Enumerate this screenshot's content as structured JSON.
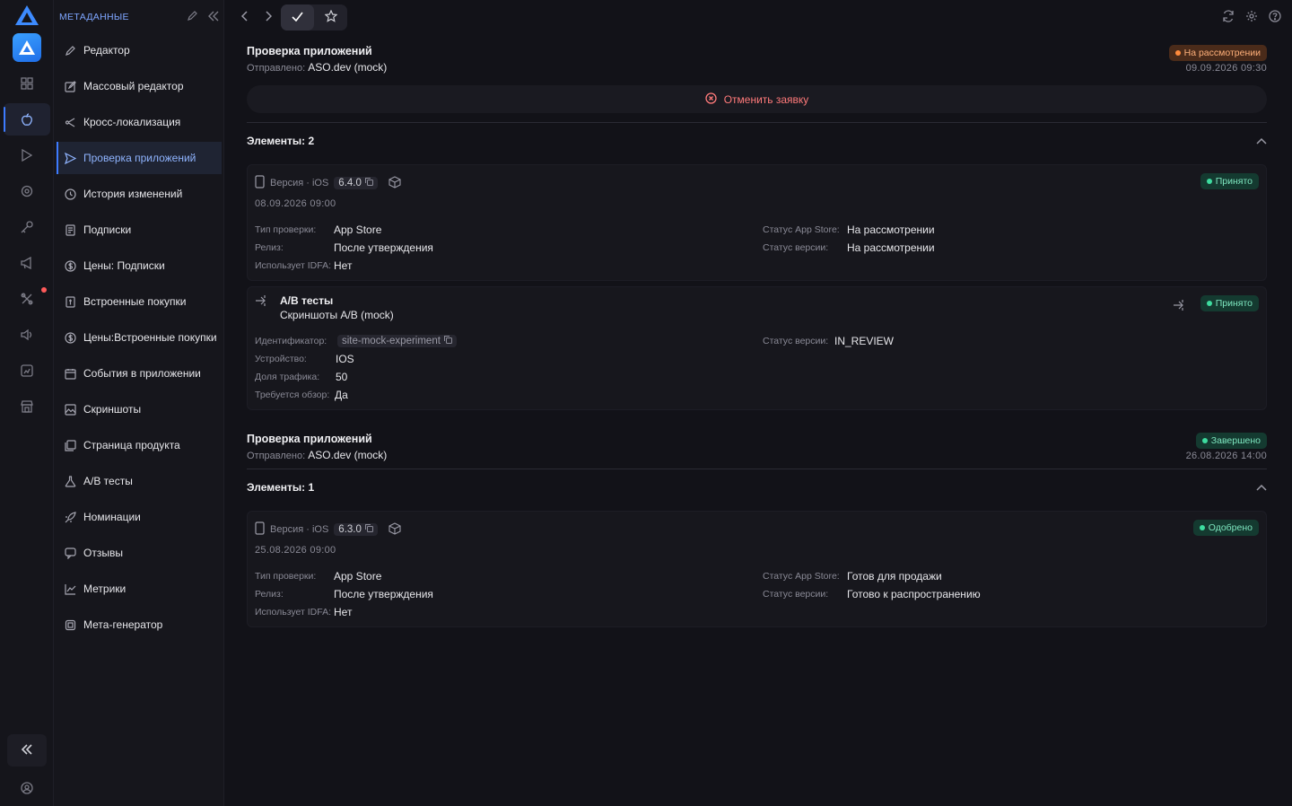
{
  "sidebar": {
    "title": "МЕТАДАННЫЕ",
    "items": [
      {
        "label": "Редактор",
        "icon": "pencil-icon"
      },
      {
        "label": "Массовый редактор",
        "icon": "edit-square-icon"
      },
      {
        "label": "Кросс-локализация",
        "icon": "share-icon"
      },
      {
        "label": "Проверка приложений",
        "icon": "send-icon"
      },
      {
        "label": "История изменений",
        "icon": "history-icon"
      },
      {
        "label": "Подписки",
        "icon": "document-icon"
      },
      {
        "label": "Цены: Подписки",
        "icon": "dollar-circle-icon"
      },
      {
        "label": "Встроенные покупки",
        "icon": "receipt-icon"
      },
      {
        "label": "Цены:Встроенные покупки",
        "icon": "dollar-circle-icon"
      },
      {
        "label": "События в приложении",
        "icon": "calendar-icon"
      },
      {
        "label": "Скриншоты",
        "icon": "image-icon"
      },
      {
        "label": "Страница продукта",
        "icon": "pages-icon"
      },
      {
        "label": "A/B тесты",
        "icon": "flask-icon"
      },
      {
        "label": "Номинации",
        "icon": "rocket-icon"
      },
      {
        "label": "Отзывы",
        "icon": "chat-icon"
      },
      {
        "label": "Метрики",
        "icon": "chart-icon"
      },
      {
        "label": "Мета-генератор",
        "icon": "chip-icon"
      }
    ]
  },
  "review1": {
    "title": "Проверка приложений",
    "sent_label": "Отправлено:",
    "sent_value": "ASO.dev (mock)",
    "status": "На рассмотрении",
    "date": "09.09.2026 09:30",
    "cancel_label": "Отменить заявку",
    "elements_label": "Элементы: 2",
    "version_card": {
      "label": "Версия · iOS",
      "version": "6.4.0",
      "date": "08.09.2026 09:00",
      "badge": "Принято",
      "check_type_k": "Тип проверки:",
      "check_type_v": "App Store",
      "release_k": "Релиз:",
      "release_v": "После утверждения",
      "idfa_k": "Использует IDFA:",
      "idfa_v": "Нет",
      "store_status_k": "Статус App Store:",
      "store_status_v": "На рассмотрении",
      "version_status_k": "Статус версии:",
      "version_status_v": "На рассмотрении"
    },
    "ab_card": {
      "title": "A/B тесты",
      "subtitle": "Скриншоты A/B (mock)",
      "badge": "Принято",
      "id_k": "Идентификатор:",
      "id_v": "site-mock-experiment",
      "device_k": "Устройство:",
      "device_v": "IOS",
      "traffic_k": "Доля трафика:",
      "traffic_v": "50",
      "review_k": "Требуется обзор:",
      "review_v": "Да",
      "version_status_k": "Статус версии:",
      "version_status_v": "IN_REVIEW"
    }
  },
  "review2": {
    "title": "Проверка приложений",
    "sent_label": "Отправлено:",
    "sent_value": "ASO.dev (mock)",
    "status": "Завершено",
    "date": "26.08.2026 14:00",
    "elements_label": "Элементы: 1",
    "version_card": {
      "label": "Версия · iOS",
      "version": "6.3.0",
      "date": "25.08.2026 09:00",
      "badge": "Одобрено",
      "check_type_k": "Тип проверки:",
      "check_type_v": "App Store",
      "release_k": "Релиз:",
      "release_v": "После утверждения",
      "idfa_k": "Использует IDFA:",
      "idfa_v": "Нет",
      "store_status_k": "Статус App Store:",
      "store_status_v": "Готов для продажи",
      "version_status_k": "Статус версии:",
      "version_status_v": "Готово к распространению"
    }
  },
  "colors": {
    "accent": "#3d7bff",
    "pending": "#ff8a3c",
    "success": "#3ddc9f",
    "danger": "#ff7a7a"
  }
}
